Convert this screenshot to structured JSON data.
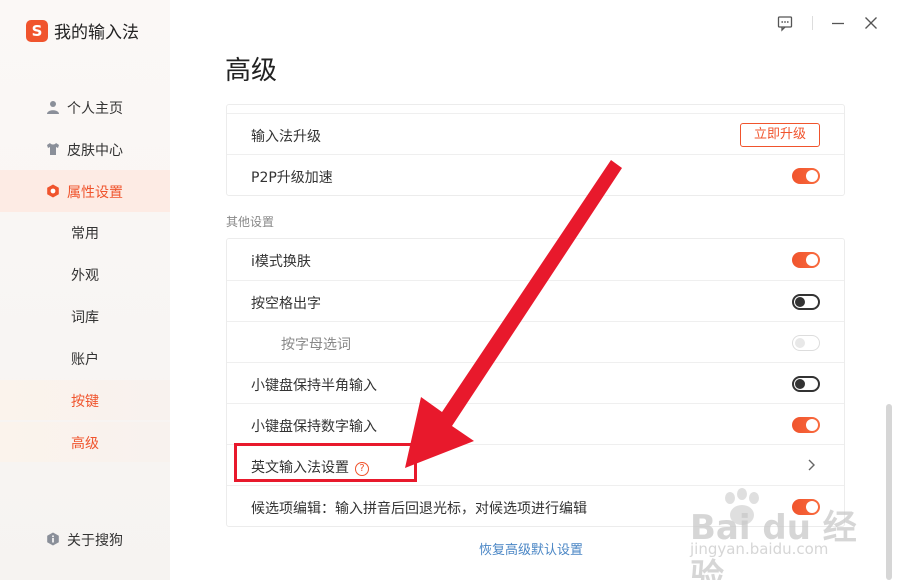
{
  "app": {
    "name": "我的输入法",
    "logo_letter": "S"
  },
  "sidebar": {
    "items": [
      {
        "label": "个人主页",
        "icon": "user-icon"
      },
      {
        "label": "皮肤中心",
        "icon": "tshirt-icon"
      },
      {
        "label": "属性设置",
        "icon": "settings-hexagon-icon"
      }
    ],
    "sub_items": [
      {
        "label": "常用"
      },
      {
        "label": "外观"
      },
      {
        "label": "词库"
      },
      {
        "label": "账户"
      },
      {
        "label": "按键"
      },
      {
        "label": "高级"
      }
    ],
    "about": {
      "label": "关于搜狗",
      "icon": "info-shield-icon"
    }
  },
  "window_controls": [
    "feedback-icon",
    "minimize-icon",
    "close-icon"
  ],
  "main": {
    "title": "高级",
    "upgrade_card": [
      {
        "label": "输入法升级",
        "control": "button",
        "button_label": "立即升级"
      },
      {
        "label": "P2P升级加速",
        "control": "toggle",
        "state": "on"
      }
    ],
    "other_section_label": "其他设置",
    "other_card": [
      {
        "label": "i模式换肤",
        "control": "toggle",
        "state": "on"
      },
      {
        "label": "按空格出字",
        "control": "toggle",
        "state": "off"
      },
      {
        "label": "按字母选词",
        "control": "toggle",
        "state": "disabled"
      },
      {
        "label": "小键盘保持半角输入",
        "control": "toggle",
        "state": "off"
      },
      {
        "label": "小键盘保持数字输入",
        "control": "toggle",
        "state": "on"
      },
      {
        "label": "英文输入法设置",
        "control": "chevron",
        "help": "?"
      },
      {
        "label": "候选项编辑：输入拼音后回退光标，对候选项进行编辑",
        "control": "toggle",
        "state": "on"
      }
    ],
    "restore_link": "恢复高级默认设置"
  },
  "watermark": {
    "text": "Bai du 经验",
    "url_text": "jingyan.baidu.com"
  },
  "colors": {
    "accent": "#f0542d",
    "annotation": "#e8192c",
    "link": "#4a86c5"
  }
}
